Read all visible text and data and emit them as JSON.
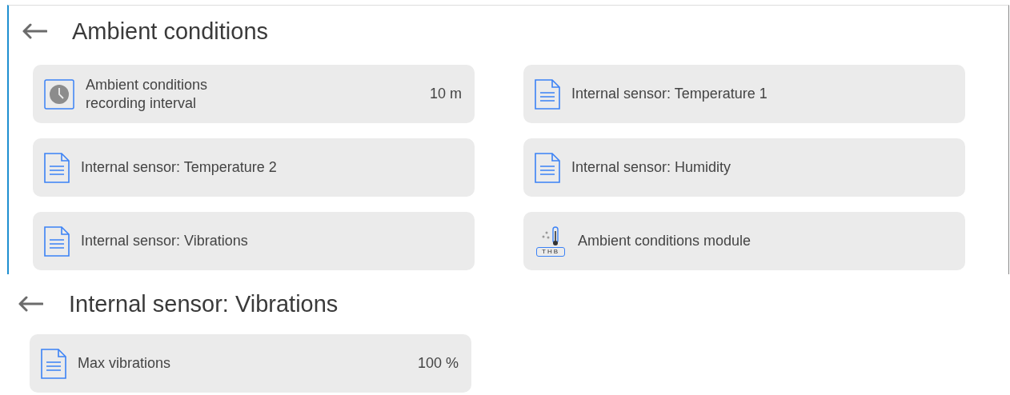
{
  "panels": [
    {
      "title": "Ambient conditions",
      "framed": true,
      "items": [
        {
          "kind": "clock",
          "label": "Ambient conditions recording interval",
          "value": "10 m"
        },
        {
          "kind": "document",
          "label": "Internal sensor: Temperature 1"
        },
        {
          "kind": "document",
          "label": "Internal sensor: Temperature 2"
        },
        {
          "kind": "document",
          "label": "Internal sensor: Humidity"
        },
        {
          "kind": "document",
          "label": "Internal sensor: Vibrations"
        },
        {
          "kind": "module",
          "label": "Ambient conditions module",
          "icon_label": "THB"
        }
      ]
    },
    {
      "title": "Internal sensor: Vibrations",
      "framed": false,
      "items": [
        {
          "kind": "document",
          "label": "Max vibrations",
          "value": "100 %"
        }
      ]
    }
  ]
}
